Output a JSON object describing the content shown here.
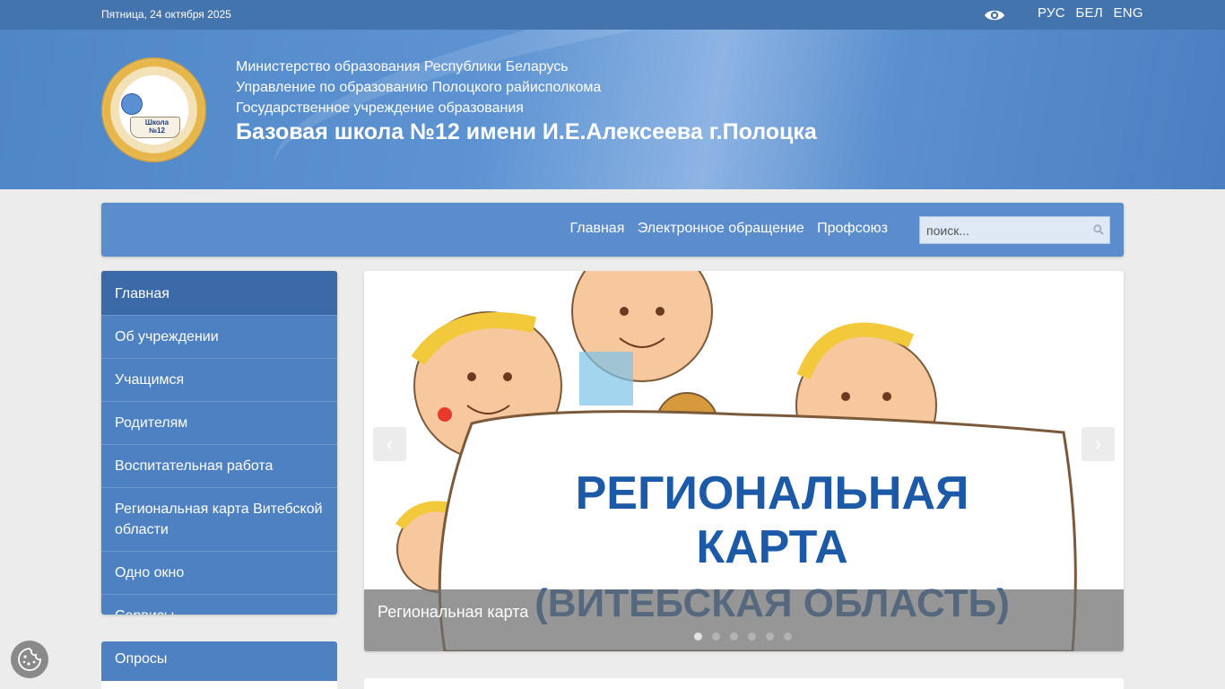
{
  "topbar": {
    "date": "Пятница, 24 октября 2025",
    "languages": [
      "РУС",
      "БЕЛ",
      "ENG"
    ]
  },
  "header": {
    "lines": [
      "Министерство образования Республики Беларусь",
      "Управление по образованию Полоцкого райисполкома",
      "Государственное учреждение образования"
    ],
    "school_name": "Базовая школа №12 имени И.Е.Алексеева г.Полоцка",
    "logo_text": "Школа №12"
  },
  "nav": {
    "items": [
      "Главная",
      "Электронное обращение",
      "Профсоюз"
    ],
    "search_placeholder": "поиск..."
  },
  "sidebar": {
    "items": [
      {
        "label": "Главная",
        "active": true
      },
      {
        "label": "Об учреждении"
      },
      {
        "label": "Учащимся"
      },
      {
        "label": "Родителям"
      },
      {
        "label": "Воспитательная работа"
      },
      {
        "label": "Региональная карта Витебской области"
      },
      {
        "label": "Одно окно"
      },
      {
        "label": "Сервисы"
      }
    ]
  },
  "polls": {
    "title": "Опросы"
  },
  "slider": {
    "image_text": [
      "РЕГИОНАЛЬНАЯ",
      "КАРТА",
      "(ВИТЕБСКАЯ ОБЛАСТЬ)"
    ],
    "caption": "Региональная карта",
    "slide_count": 6,
    "active_slide": 1
  },
  "colors": {
    "topbar": "#4474ad",
    "navbar": "#5b8ccb",
    "sidebar": "#4e81c2",
    "sidebar_active": "#3c6aa8",
    "page_bg": "#ececec"
  }
}
